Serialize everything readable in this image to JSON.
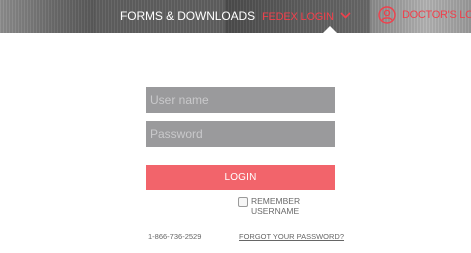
{
  "nav": {
    "forms_label": "FORMS & DOWNLOADS",
    "fedex_login_label": "FEDEX LOGIN",
    "fedex_icon": "chevron-down-icon",
    "doctors_login_label": "DOCTOR'S LOGI",
    "doctor_icon": "user-circle-icon",
    "accent_color": "#f0404c"
  },
  "login": {
    "username_placeholder": "User name",
    "password_placeholder": "Password",
    "button_label": "LOGIN",
    "button_color": "#f2646b",
    "remember_label": "REMEMBER USERNAME",
    "remember_checked": false,
    "phone": "1-866-736-2529",
    "forgot_label": "FORGOT YOUR PASSWORD?"
  }
}
